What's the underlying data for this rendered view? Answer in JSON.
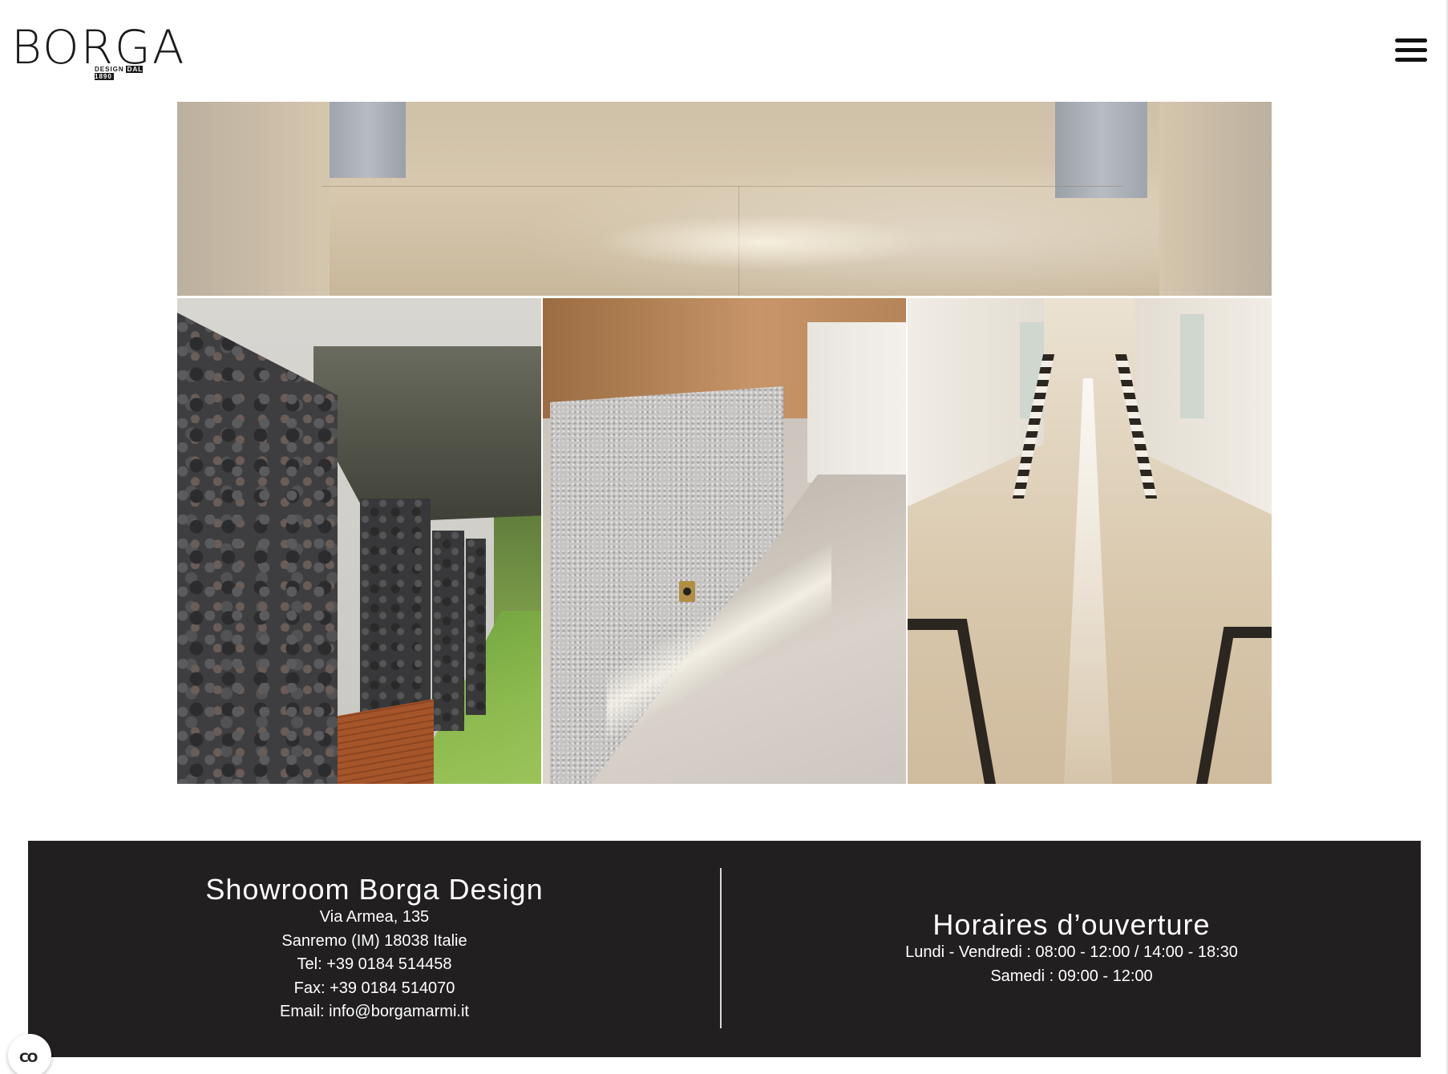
{
  "header": {
    "logo_text": "BORGA",
    "logo_subtext": "DESIGN",
    "logo_since": "DAL 1890",
    "menu_icon": "hamburger-menu-icon"
  },
  "gallery": {
    "images": [
      {
        "description_name": "marble-floor-image"
      },
      {
        "description_name": "lava-stone-wall-image"
      },
      {
        "description_name": "plaster-wall-image"
      },
      {
        "description_name": "marble-corridor-image"
      }
    ]
  },
  "footer": {
    "showroom": {
      "title": "Showroom Borga Design",
      "address": "Via Armea, 135",
      "city": "Sanremo (IM) 18038 Italie",
      "tel": "Tel: +39 0184 514458",
      "fax": "Fax: +39 0184 514070",
      "email": "Email: info@borgamarmi.it"
    },
    "hours": {
      "title": "Horaires d’ouverture",
      "weekdays": "Lundi - Vendredi : 08:00 - 12:00 / 14:00 - 18:30",
      "saturday": "Samedi : 09:00 - 12:00"
    },
    "colors": {
      "background": "#221f20",
      "text": "#ffffff"
    }
  },
  "consent": {
    "icon": "cookie-consent-icon",
    "icon_glyph": "CO"
  }
}
